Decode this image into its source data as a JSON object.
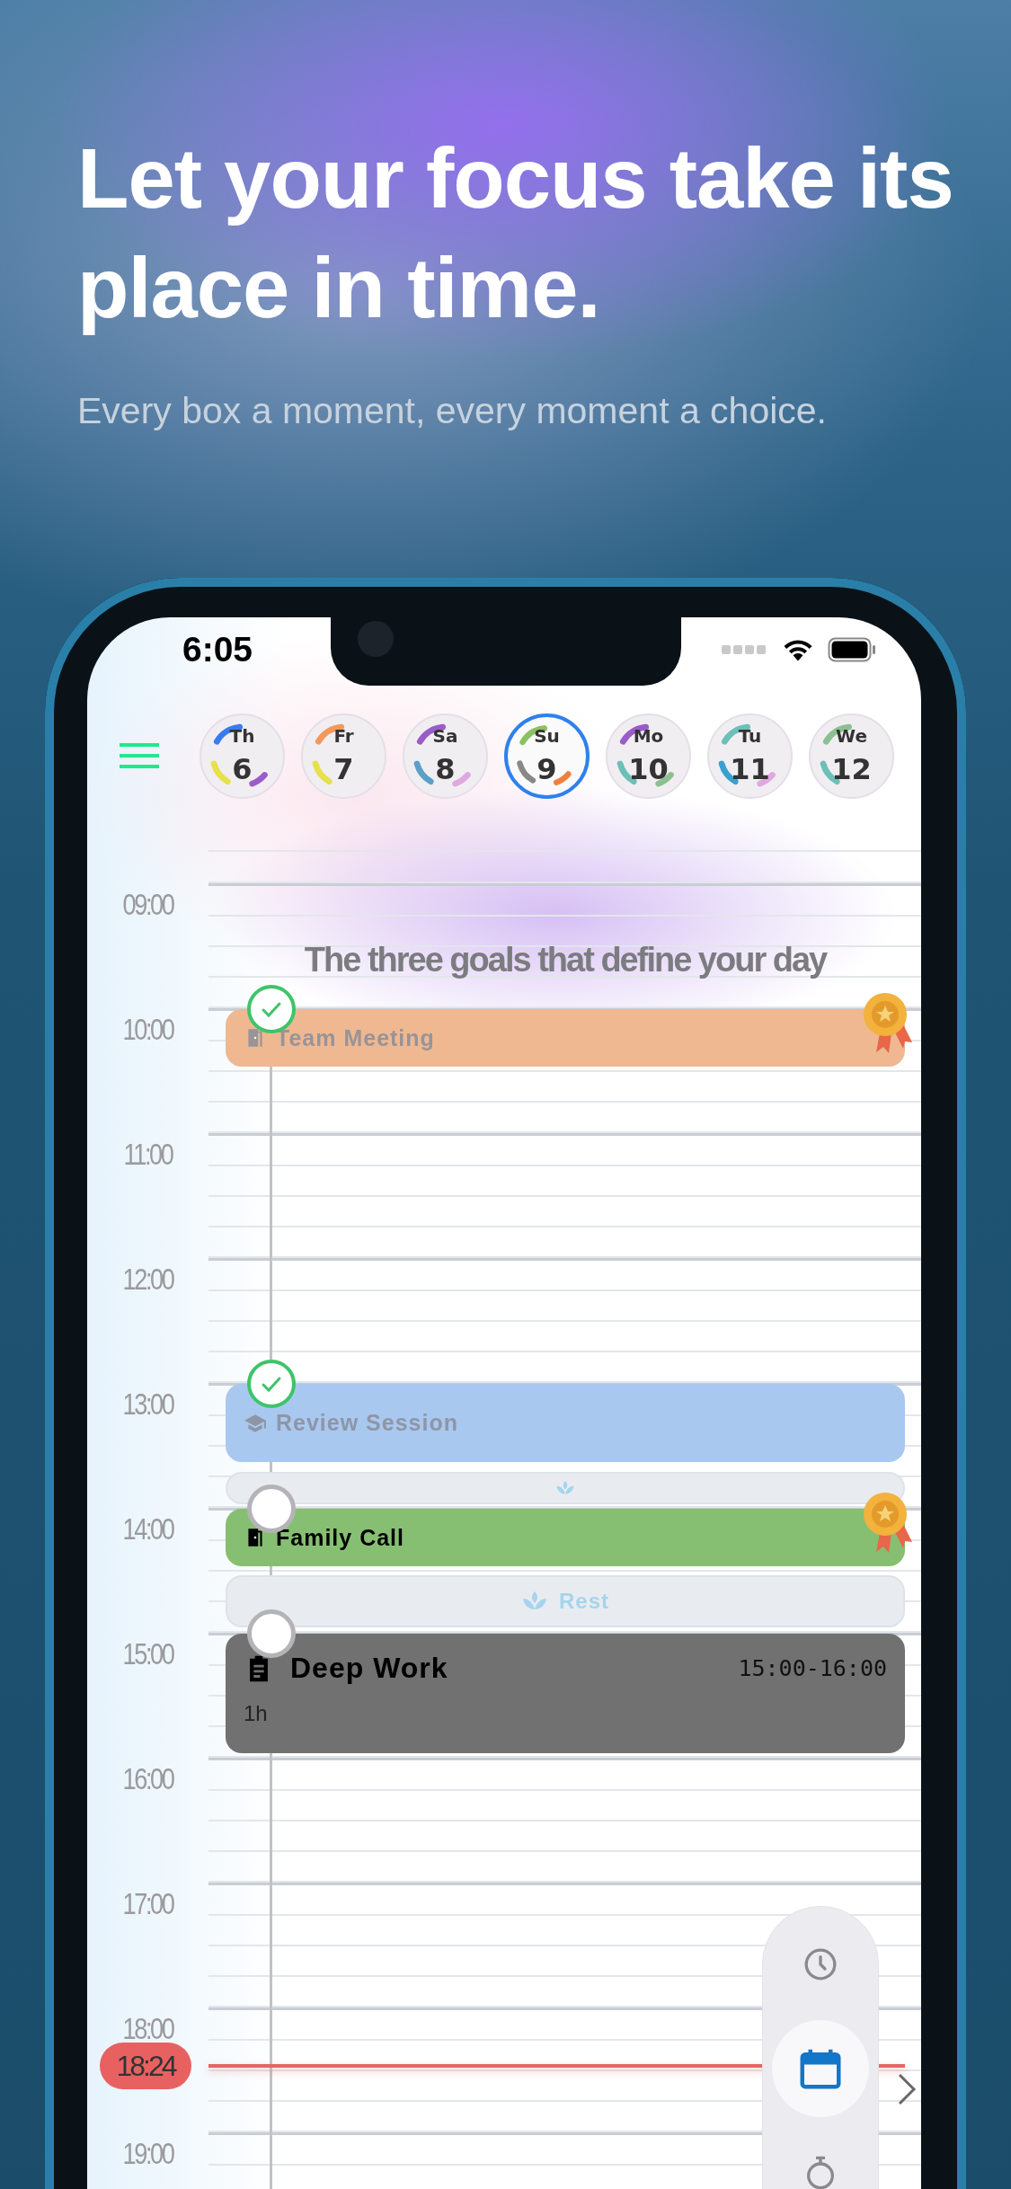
{
  "headline": "Let your focus take its place in time.",
  "subtitle": "Every box a moment, every moment a choice.",
  "status_bar": {
    "time": "6:05"
  },
  "days": [
    {
      "weekday": "Th",
      "date": "6",
      "selected": false
    },
    {
      "weekday": "Fr",
      "date": "7",
      "selected": false
    },
    {
      "weekday": "Sa",
      "date": "8",
      "selected": false
    },
    {
      "weekday": "Su",
      "date": "9",
      "selected": true
    },
    {
      "weekday": "Mo",
      "date": "10",
      "selected": false
    },
    {
      "weekday": "Tu",
      "date": "11",
      "selected": false
    },
    {
      "weekday": "We",
      "date": "12",
      "selected": false
    }
  ],
  "timeline": {
    "hours": [
      "09:00",
      "10:00",
      "11:00",
      "12:00",
      "13:00",
      "14:00",
      "15:00",
      "16:00",
      "17:00",
      "18:00",
      "19:00"
    ],
    "goals_title": "The three goals that define your day",
    "events": [
      {
        "kind": "task",
        "title": "Team Meeting",
        "color": "#efb891",
        "done": true,
        "medal": true
      },
      {
        "kind": "task",
        "title": "Review Session",
        "color": "#a9c8f0",
        "done": true,
        "medal": false
      },
      {
        "kind": "rest"
      },
      {
        "kind": "task",
        "title": "Family Call",
        "color": "#86bf72",
        "done": false,
        "medal": true
      },
      {
        "kind": "rest",
        "label": "Rest"
      },
      {
        "kind": "task",
        "title": "Deep Work",
        "color": "#717171",
        "done": false,
        "medal": false,
        "time": "15:00-16:00",
        "duration": "1h"
      }
    ],
    "now": "18:24"
  },
  "dock": [
    {
      "kind": "clock",
      "selected": false
    },
    {
      "kind": "calendar",
      "selected": true
    },
    {
      "kind": "stopwatch",
      "selected": false
    }
  ]
}
